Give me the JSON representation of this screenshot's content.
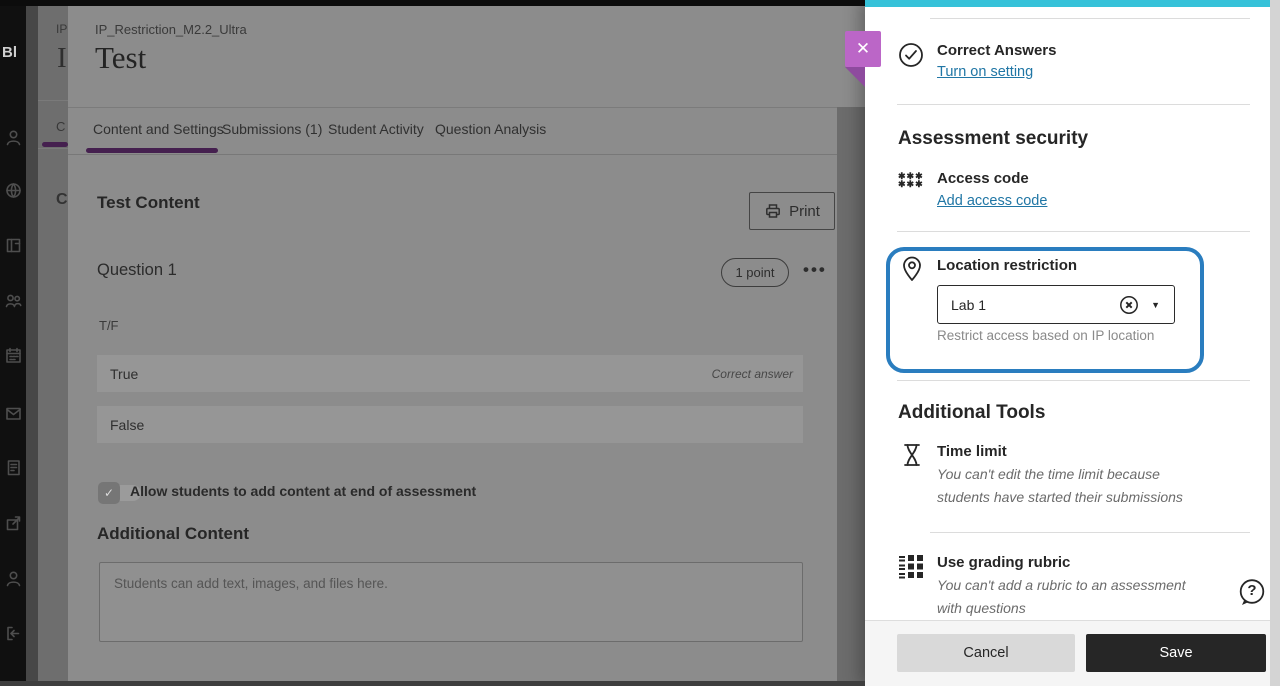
{
  "window": {
    "logo": "Bl",
    "sidebar_icons": [
      "profile",
      "activity-stream",
      "courses",
      "organizations",
      "calendar",
      "messages",
      "grades",
      "tools",
      "profile-secondary",
      "sign-out"
    ]
  },
  "ghost": {
    "breadcrumb": "IP",
    "title": "I",
    "tab": "C",
    "content_heading": "C"
  },
  "card": {
    "breadcrumb": "IP_Restriction_M2.2_Ultra",
    "title": "Test",
    "tabs": [
      {
        "label": "Content and Settings",
        "active": true
      },
      {
        "label": "Submissions (1)",
        "active": false
      },
      {
        "label": "Student Activity",
        "active": false
      },
      {
        "label": "Question Analysis",
        "active": false
      }
    ],
    "content_heading": "Test Content",
    "print_button": "Print",
    "question": {
      "heading": "Question 1",
      "points_badge": "1 point",
      "stem": "T/F",
      "answers": [
        {
          "label": "True",
          "note": "Correct answer"
        },
        {
          "label": "False",
          "note": ""
        }
      ]
    },
    "toggle_label": "Allow students to add content at end of assessment",
    "additional_content_heading": "Additional Content",
    "editor_placeholder": "Students can add text, images, and files here."
  },
  "panel": {
    "correct_answers": {
      "title": "Correct Answers",
      "link": "Turn on setting"
    },
    "assessment_security": {
      "heading": "Assessment security",
      "access_code": {
        "title": "Access code",
        "link": "Add access code"
      },
      "location_restriction": {
        "title": "Location restriction",
        "selected_value": "Lab 1",
        "helper": "Restrict access based on IP location"
      }
    },
    "additional_tools": {
      "heading": "Additional Tools",
      "time_limit": {
        "title": "Time limit",
        "note_line1": "You can't edit the time limit because",
        "note_line2": "students have started their submissions"
      },
      "grading_rubric": {
        "title": "Use grading rubric",
        "note_line1": "You can't add a rubric to an assessment",
        "note_line2": "with questions"
      }
    },
    "footer": {
      "cancel": "Cancel",
      "save": "Save"
    }
  },
  "icons": {
    "more_options": "•••",
    "caret_down": "▼",
    "close": "✕",
    "access_code_glyph_row": "✱✱✱",
    "toggle_check": "✓",
    "question_mark": "?"
  },
  "colors": {
    "teal_bar": "#36c2d9",
    "highlight_border": "#2a7dbf",
    "link": "#2076a5",
    "close_button": "#bb66c7",
    "close_fold": "#8e4b9e",
    "tab_underline_dimmed": "#45204f",
    "save_button_bg": "#262626"
  }
}
